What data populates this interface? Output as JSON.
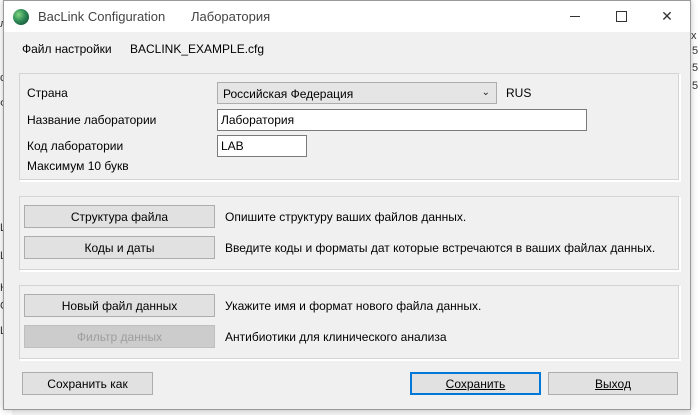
{
  "window": {
    "title": "BacLink Configuration",
    "subtitle": "Лаборатория"
  },
  "settings_file": {
    "label": "Файл настройки",
    "value": "BACLINK_EXAMPLE.cfg"
  },
  "country": {
    "label": "Страна",
    "selected": "Российская Федерация",
    "code": "RUS"
  },
  "lab_name": {
    "label": "Название лаборатории",
    "value": "Лаборатория"
  },
  "lab_code": {
    "label": "Код лаборатории",
    "value": "LAB",
    "hint": "Максимум 10 букв"
  },
  "file_structure": {
    "button": "Структура файла",
    "description": "Опишите структуру ваших файлов данных."
  },
  "codes_dates": {
    "button": "Коды и даты",
    "description": "Введите коды и форматы дат которые встречаются в ваших файлах данных."
  },
  "new_file": {
    "button": "Новый файл данных",
    "description": "Укажите имя и формат нового файла данных."
  },
  "data_filter": {
    "button": "Фильтр данных",
    "description": "Антибиотики для клинического анализа"
  },
  "footer": {
    "save_as": "Сохранить как",
    "save": "Сохранить",
    "exit": "Выход"
  },
  "background_fragments": {
    "right": [
      "x",
      "5",
      "5",
      "5"
    ],
    "left": [
      "л",
      "Ф",
      "c",
      "L",
      "L",
      "H",
      "C",
      "L"
    ]
  }
}
